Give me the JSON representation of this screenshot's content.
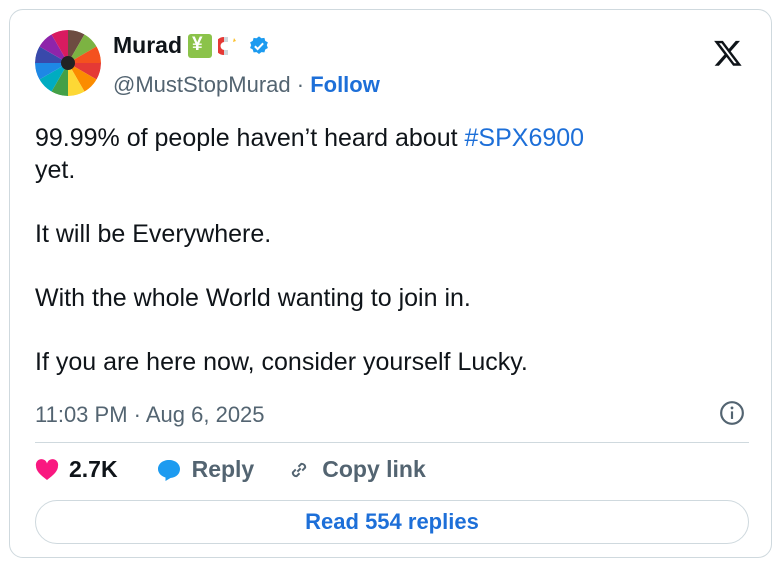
{
  "author": {
    "name": "Murad",
    "handle": "@MustStopMurad",
    "separator": " · ",
    "follow_label": "Follow"
  },
  "tweet": {
    "line1_prefix": "99.99% of people haven’t heard about ",
    "hashtag": "#SPX6900",
    "line1_suffix": "yet.",
    "line2": "It will be Everywhere.",
    "line3": "With the whole World wanting to join in.",
    "line4": "If you are here now, consider yourself Lucky.",
    "timestamp": "11:03 PM · Aug 6, 2025"
  },
  "actions": {
    "likes": "2.7K",
    "reply_label": "Reply",
    "copy_link_label": "Copy link"
  },
  "read_replies_label": "Read 554 replies",
  "icons": {
    "like": "heart-icon",
    "reply": "speech-bubble-icon",
    "copy": "link-icon",
    "brand": "x-logo-icon",
    "info": "info-icon",
    "verified": "verified-badge-icon"
  },
  "colors": {
    "accent": "#1d6fd8",
    "heart": "#f91880",
    "muted": "#536471"
  }
}
